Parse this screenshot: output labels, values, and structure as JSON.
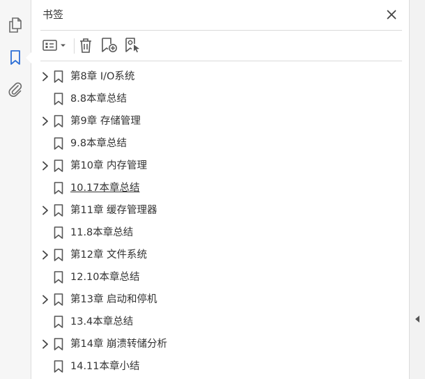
{
  "nav_rail": {
    "items": [
      {
        "name": "pages-icon",
        "active": false
      },
      {
        "name": "bookmark-icon",
        "active": true
      },
      {
        "name": "attachment-icon",
        "active": false
      }
    ],
    "active_color": "#2d6fd6",
    "icon_color": "#6b6b6b"
  },
  "panel": {
    "title": "书签",
    "close_icon": "close-icon"
  },
  "toolbar": {
    "items": [
      "options-menu-icon",
      "delete-bookmark-icon",
      "new-bookmark-icon",
      "bookmark-from-selection-icon"
    ]
  },
  "bookmarks": [
    {
      "label": "第8章  I/O系统",
      "expandable": true
    },
    {
      "label": "8.8本章总结",
      "expandable": false
    },
    {
      "label": "第9章  存储管理",
      "expandable": true
    },
    {
      "label": "9.8本章总结",
      "expandable": false
    },
    {
      "label": "第10章  内存管理",
      "expandable": true
    },
    {
      "label": "10.17本章总结",
      "expandable": false,
      "hover": true
    },
    {
      "label": "第11章  缓存管理器",
      "expandable": true
    },
    {
      "label": "11.8本章总结",
      "expandable": false
    },
    {
      "label": "第12章  文件系统",
      "expandable": true
    },
    {
      "label": "12.10本章总结",
      "expandable": false
    },
    {
      "label": "第13章  启动和停机",
      "expandable": true
    },
    {
      "label": "13.4本章总结",
      "expandable": false
    },
    {
      "label": "第14章  崩溃转储分析",
      "expandable": true
    },
    {
      "label": "14.11本章小结",
      "expandable": false
    }
  ],
  "right_strip": {
    "collapse_icon": "collapse-panel-icon"
  }
}
